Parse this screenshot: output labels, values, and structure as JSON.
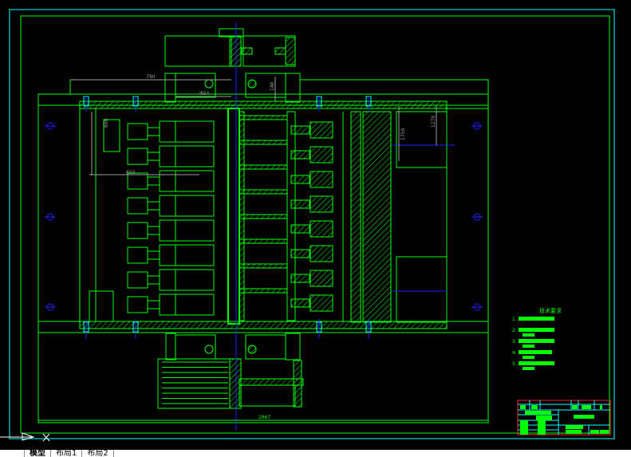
{
  "drawing": {
    "colors": {
      "background": "#000000",
      "geometry": "#00ff00",
      "frame": "#00ffff",
      "centerline": "#0000ff",
      "dimension": "#a0a0a0",
      "title_block_border": "#ff0000"
    },
    "dimensions": {
      "top_width": "790",
      "bearing": "Φ54",
      "bearing_height": "140",
      "left_height": "600",
      "left_depth": "850",
      "right_a": "1750",
      "right_b": "1270",
      "overall_width": "2867"
    },
    "notes": {
      "title": "技术要求",
      "items": [
        "1.",
        "2.",
        "3.",
        "4.",
        "5."
      ]
    }
  },
  "tabs": {
    "items": [
      {
        "label": "模型",
        "active": true
      },
      {
        "label": "布局1",
        "active": false
      },
      {
        "label": "布局2",
        "active": false
      }
    ]
  }
}
